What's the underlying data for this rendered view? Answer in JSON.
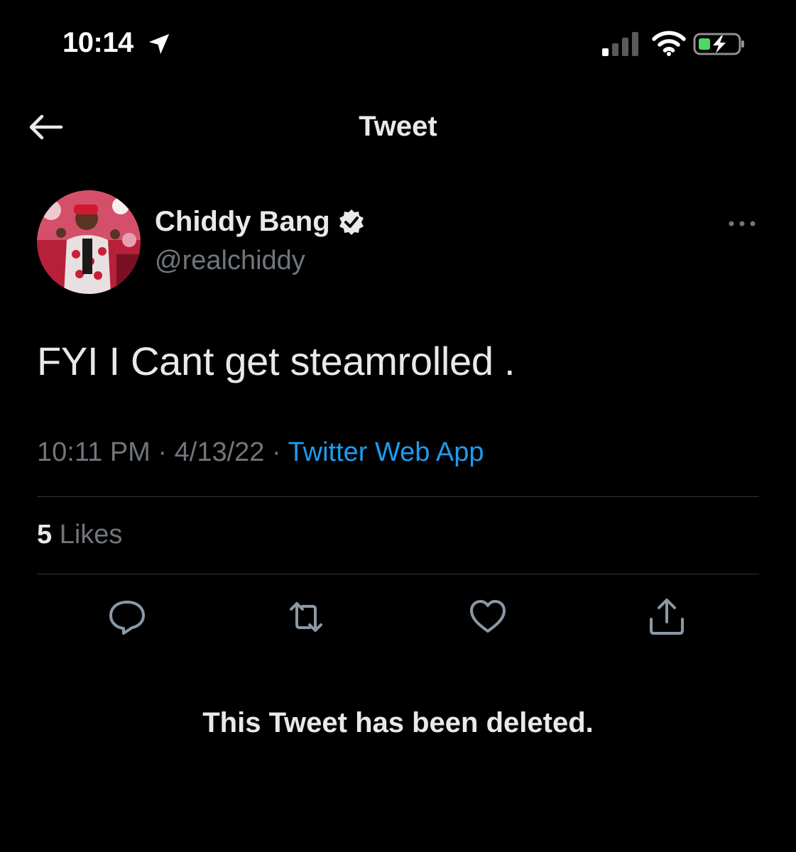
{
  "status_bar": {
    "time": "10:14",
    "icons": [
      "location-arrow-icon",
      "cellular-signal-icon",
      "wifi-icon",
      "battery-charging-icon"
    ]
  },
  "header": {
    "title": "Tweet",
    "back_icon": "arrow-left-icon"
  },
  "author": {
    "display_name": "Chiddy Bang",
    "handle": "@realchiddy",
    "verified_icon": "verified-badge-icon"
  },
  "more_icon": "more-horizontal-icon",
  "tweet": {
    "text": "FYI I Cant get steamrolled .",
    "time": "10:11 PM",
    "date": "4/13/22",
    "separator": "·",
    "source": "Twitter Web App"
  },
  "stats": {
    "likes_count": "5",
    "likes_label": "Likes"
  },
  "actions": [
    "reply-icon",
    "retweet-icon",
    "like-icon",
    "share-icon"
  ],
  "notice": "This Tweet has been deleted.",
  "colors": {
    "background": "#000000",
    "text_primary": "#e7e9ea",
    "text_secondary": "#71767b",
    "link": "#1d9bf0",
    "divider": "#2f3336",
    "battery_green": "#4cd964"
  }
}
